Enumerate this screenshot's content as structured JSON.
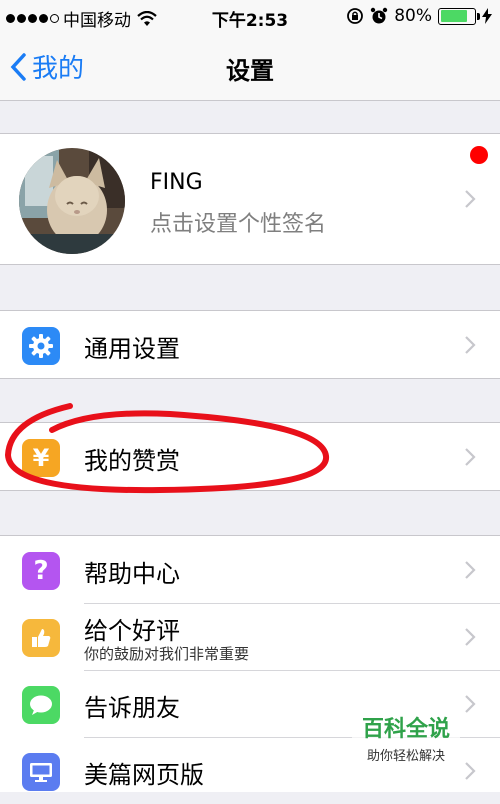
{
  "status_bar": {
    "carrier": "中国移动",
    "time": "下午2:53",
    "battery": "80%",
    "battery_level": 0.8,
    "battery_color": "#4cd964"
  },
  "nav": {
    "back_label": "我的",
    "title": "设置",
    "accent_color": "#1a7cf5"
  },
  "profile": {
    "name": "FING",
    "signature": "点击设置个性签名",
    "badge_color": "#ff0000"
  },
  "settings": {
    "general": "通用设置",
    "appreciation": "我的赞赏",
    "appreciation_symbol": "¥"
  },
  "more": {
    "help": "帮助中心",
    "rate": "给个好评",
    "rate_sub": "你的鼓励对我们非常重要",
    "tell_friends": "告诉朋友",
    "web_version": "美篇网页版"
  },
  "watermark": {
    "title": "百科全说",
    "subtitle": "助你轻松解决"
  },
  "icons": {
    "general": "gear-icon",
    "appreciation": "yen-icon",
    "help": "question-icon",
    "rate": "thumbs-up-icon",
    "tell_friends": "chat-bubble-icon",
    "web_version": "monitor-icon"
  }
}
